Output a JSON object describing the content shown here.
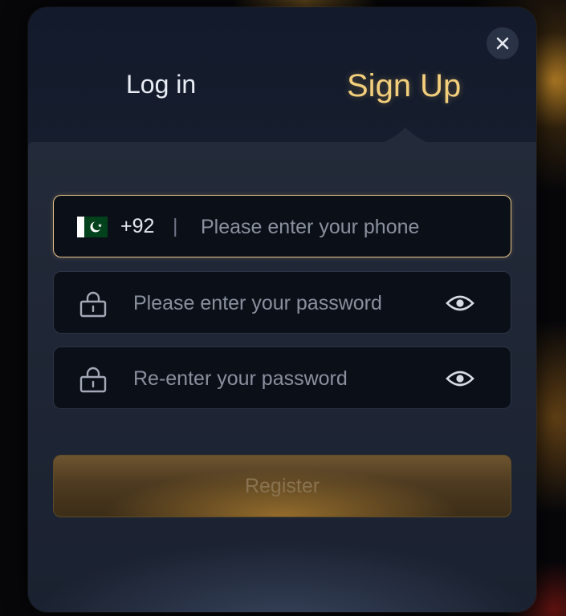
{
  "tabs": {
    "login_label": "Log in",
    "signup_label": "Sign Up",
    "active": "Sign Up"
  },
  "phone_field": {
    "country_flag": "pakistan-flag-icon",
    "country_code": "+92",
    "separator": "|",
    "placeholder": "Please enter your phone",
    "value": ""
  },
  "password_field": {
    "placeholder": "Please enter your password",
    "value": ""
  },
  "confirm_password_field": {
    "placeholder": "Re-enter your password",
    "value": ""
  },
  "register_button": {
    "label": "Register"
  },
  "icons": {
    "close": "close-icon",
    "lock": "lock-icon",
    "eye": "eye-icon"
  },
  "colors": {
    "accent_gold": "#f3cf7c",
    "focused_border": "#e8c489",
    "modal_bg": "#1d2434",
    "field_bg": "#0b0f18"
  }
}
